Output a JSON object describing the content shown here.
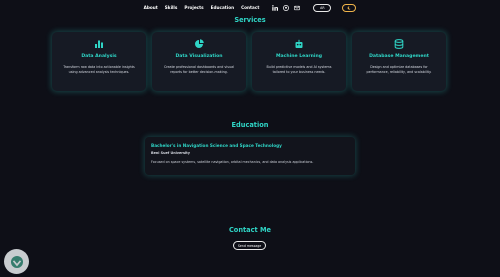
{
  "nav": {
    "links": [
      "About",
      "Skills",
      "Projects",
      "Education",
      "Contact"
    ],
    "lang_label": "AR",
    "theme_icon": "moon-icon",
    "social_icons": [
      "linkedin-icon",
      "github-icon",
      "email-icon"
    ]
  },
  "services": {
    "title": "Services",
    "items": [
      {
        "icon": "bar-chart-icon",
        "title": "Data Analysis",
        "desc": "Transform raw data into actionable insights using advanced analysis techniques."
      },
      {
        "icon": "pie-chart-icon",
        "title": "Data Visualization",
        "desc": "Create professional dashboards and visual reports for better decision-making."
      },
      {
        "icon": "robot-icon",
        "title": "Machine Learning",
        "desc": "Build predictive models and AI systems tailored to your business needs."
      },
      {
        "icon": "database-icon",
        "title": "Database Management",
        "desc": "Design and optimize databases for performance, reliability, and scalability."
      }
    ]
  },
  "education": {
    "title": "Education",
    "degree": "Bachelor's in Navigation Science and Space Technology",
    "university": "Beni Suef University",
    "desc": "Focused on space systems, satellite navigation, orbital mechanics, and data analysis applications."
  },
  "contact": {
    "title": "Contact Me",
    "button": "Send message"
  },
  "colors": {
    "accent": "#2fd5c6",
    "background": "#0e0f17",
    "card": "#161a24"
  }
}
